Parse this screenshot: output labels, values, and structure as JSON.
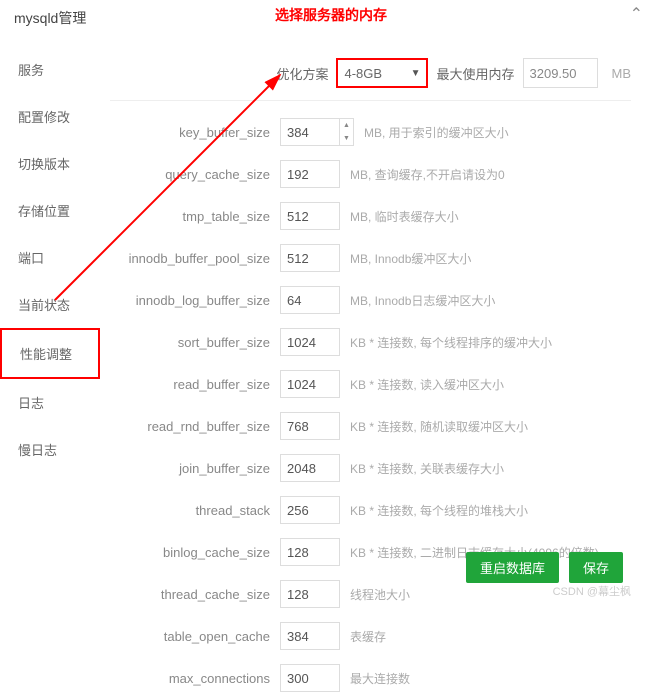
{
  "annotation": "选择服务器的内存",
  "header": {
    "title": "mysqld管理"
  },
  "sidebar": {
    "items": [
      {
        "label": "服务"
      },
      {
        "label": "配置修改"
      },
      {
        "label": "切换版本"
      },
      {
        "label": "存储位置"
      },
      {
        "label": "端口"
      },
      {
        "label": "当前状态"
      },
      {
        "label": "性能调整"
      },
      {
        "label": "日志"
      },
      {
        "label": "慢日志"
      }
    ]
  },
  "top": {
    "plan_label": "优化方案",
    "plan_value": "4-8GB",
    "max_label": "最大使用内存",
    "max_value": "3209.50",
    "unit": "MB"
  },
  "settings": [
    {
      "key": "key_buffer_size",
      "value": "384",
      "desc": "MB, 用于索引的缓冲区大小",
      "spinner": true
    },
    {
      "key": "query_cache_size",
      "value": "192",
      "desc": "MB, 查询缓存,不开启请设为0"
    },
    {
      "key": "tmp_table_size",
      "value": "512",
      "desc": "MB, 临时表缓存大小"
    },
    {
      "key": "innodb_buffer_pool_size",
      "value": "512",
      "desc": "MB, Innodb缓冲区大小"
    },
    {
      "key": "innodb_log_buffer_size",
      "value": "64",
      "desc": "MB, Innodb日志缓冲区大小"
    },
    {
      "key": "sort_buffer_size",
      "value": "1024",
      "desc": "KB * 连接数, 每个线程排序的缓冲大小"
    },
    {
      "key": "read_buffer_size",
      "value": "1024",
      "desc": "KB * 连接数, 读入缓冲区大小"
    },
    {
      "key": "read_rnd_buffer_size",
      "value": "768",
      "desc": "KB * 连接数, 随机读取缓冲区大小"
    },
    {
      "key": "join_buffer_size",
      "value": "2048",
      "desc": "KB * 连接数, 关联表缓存大小"
    },
    {
      "key": "thread_stack",
      "value": "256",
      "desc": "KB * 连接数, 每个线程的堆栈大小"
    },
    {
      "key": "binlog_cache_size",
      "value": "128",
      "desc": "KB * 连接数, 二进制日志缓存大小(4096的倍数)"
    },
    {
      "key": "thread_cache_size",
      "value": "128",
      "desc": "线程池大小"
    },
    {
      "key": "table_open_cache",
      "value": "384",
      "desc": "表缓存"
    },
    {
      "key": "max_connections",
      "value": "300",
      "desc": "最大连接数"
    }
  ],
  "footer": {
    "restart": "重启数据库",
    "save": "保存"
  },
  "watermark": "CSDN @幕尘枫"
}
